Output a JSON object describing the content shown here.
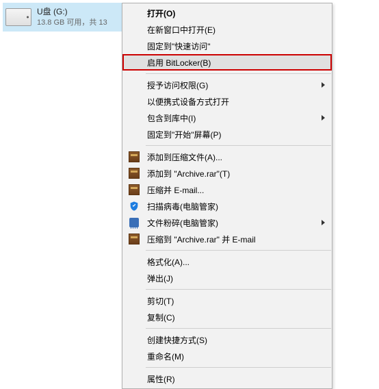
{
  "drive": {
    "name": "U盘 (G:)",
    "status": "13.8 GB 可用，共 13"
  },
  "menu": {
    "open": "打开(O)",
    "open_new_window": "在新窗口中打开(E)",
    "pin_quick_access": "固定到\"快速访问\"",
    "enable_bitlocker": "启用 BitLocker(B)",
    "grant_access": "授予访问权限(G)",
    "open_portable": "以便携式设备方式打开",
    "include_library": "包含到库中(I)",
    "pin_start": "固定到\"开始\"屏幕(P)",
    "add_archive": "添加到压缩文件(A)...",
    "add_rar": "添加到 \"Archive.rar\"(T)",
    "compress_email": "压缩并 E-mail...",
    "scan_virus": "扫描病毒(电脑管家)",
    "shred": "文件粉碎(电脑管家)",
    "compress_rar_email": "压缩到 \"Archive.rar\" 并 E-mail",
    "format": "格式化(A)...",
    "eject": "弹出(J)",
    "cut": "剪切(T)",
    "copy": "复制(C)",
    "create_shortcut": "创建快捷方式(S)",
    "rename": "重命名(M)",
    "properties": "属性(R)"
  }
}
